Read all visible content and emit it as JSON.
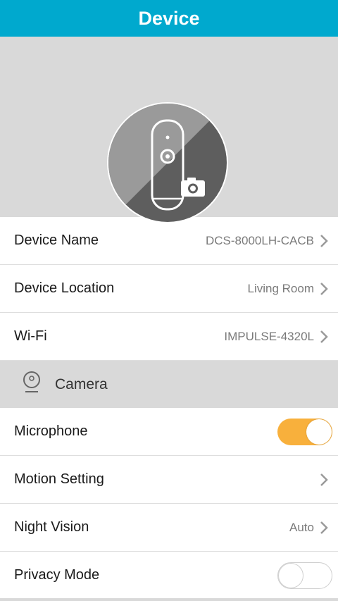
{
  "header": {
    "title": "Device"
  },
  "device_image": {
    "icon": "camera-device-icon"
  },
  "settings": [
    {
      "label": "Device Name",
      "value": "DCS-8000LH-CACB"
    },
    {
      "label": "Device Location",
      "value": "Living Room"
    },
    {
      "label": "Wi-Fi",
      "value": "IMPULSE-4320L"
    }
  ],
  "camera_section": {
    "label": "Camera",
    "icon": "webcam-icon"
  },
  "camera_settings": {
    "microphone": {
      "label": "Microphone",
      "state": "on"
    },
    "motion": {
      "label": "Motion Setting"
    },
    "night_vision": {
      "label": "Night Vision",
      "value": "Auto"
    },
    "privacy": {
      "label": "Privacy Mode",
      "state": "off"
    }
  },
  "colors": {
    "header": "#00a9ce",
    "toggle_on": "#f8b03c"
  }
}
